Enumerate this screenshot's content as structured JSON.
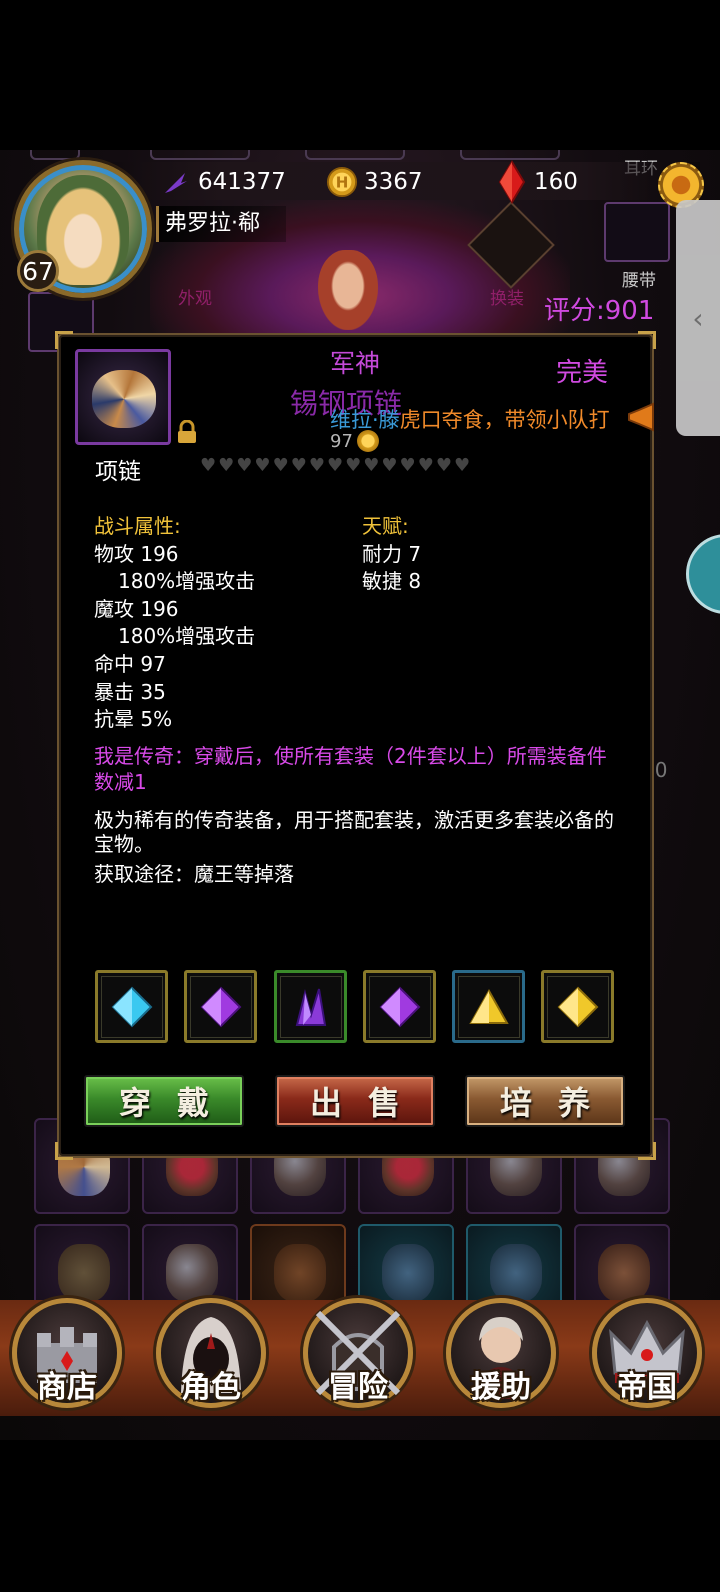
{
  "header": {
    "player_name": "弗罗拉·郗",
    "level": "67",
    "soul_crystals": "641377",
    "gold": "3367",
    "red_gems": "160"
  },
  "character_panel": {
    "appearance_label": "外观",
    "swap_outfit_label": "换装",
    "rating": "评分:901",
    "slot_earring": "耳环",
    "slot_belt": "腰带",
    "right_value": "00"
  },
  "item": {
    "name_line1": "军神",
    "name_line2": "锡钢项链",
    "quality": "完美",
    "slot_type": "项链",
    "price": "97",
    "hearts_count": 15,
    "combat_title": "战斗属性:",
    "combat_stats": [
      "物攻 196",
      "180%增强攻击",
      "魔攻 196",
      "180%增强攻击",
      "命中 97",
      "暴击 35",
      "抗晕 5%"
    ],
    "talent_title": "天赋:",
    "talents": [
      "耐力 7",
      "敏捷 8"
    ],
    "legend_effect": "我是传奇：穿戴后，使所有套装（2件套以上）所需装备件数减1",
    "description": "极为稀有的传奇装备，用于搭配套装，激活更多套装必备的宝物。",
    "source": "获取途径：魔王等掉落",
    "sockets": [
      {
        "gem": "blue-diamond-icon",
        "color": "#3ac8f0",
        "border": "gold"
      },
      {
        "gem": "purple-diamond-icon",
        "color": "#a03ae0",
        "border": "gold"
      },
      {
        "gem": "purple-crystal-cluster-icon",
        "color": "#8a3ad8",
        "border": "green"
      },
      {
        "gem": "purple-diamond-icon",
        "color": "#a03ae0",
        "border": "gold"
      },
      {
        "gem": "yellow-triangle-gem-icon",
        "color": "#f0c82a",
        "border": "blue"
      },
      {
        "gem": "yellow-diamond-icon",
        "color": "#f0c82a",
        "border": "gold"
      }
    ]
  },
  "chat_marquee": {
    "sender": "维拉·滕",
    "message": "虎口夺食，带领小队打"
  },
  "actions": {
    "equip": "穿戴",
    "sell": "出售",
    "cultivate": "培养"
  },
  "nav": {
    "shop": "商店",
    "character": "角色",
    "adventure": "冒险",
    "support": "援助",
    "empire": "帝国"
  },
  "colors": {
    "legendary_purple": "#d84ae8",
    "section_gold": "#f0c23a",
    "chat_blue": "#3a9ad8",
    "chat_orange": "#f08a2a"
  }
}
